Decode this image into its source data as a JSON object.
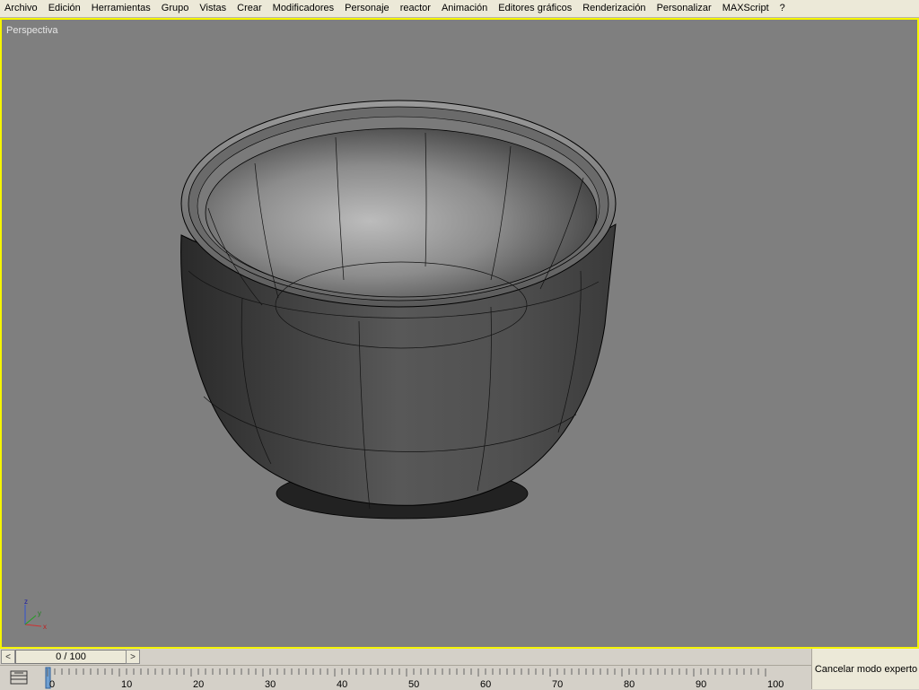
{
  "menu": {
    "items": [
      "Archivo",
      "Edición",
      "Herramientas",
      "Grupo",
      "Vistas",
      "Crear",
      "Modificadores",
      "Personaje",
      "reactor",
      "Animación",
      "Editores gráficos",
      "Renderización",
      "Personalizar",
      "MAXScript",
      "?"
    ]
  },
  "viewport": {
    "label": "Perspectiva",
    "border_color": "#f5f500",
    "background": "#7f7f7f",
    "object": "bowl"
  },
  "axis": {
    "x": "x",
    "y": "y",
    "z": "z"
  },
  "timeline": {
    "frame_display": "0 / 100",
    "prev_icon": "chevron-left-icon",
    "next_icon": "chevron-right-icon",
    "current_frame": 0,
    "total_frames": 100,
    "ticks": [
      "0",
      "10",
      "20",
      "30",
      "40",
      "50",
      "60",
      "70",
      "80",
      "90",
      "100"
    ]
  },
  "expert_button": {
    "label": "Cancelar modo experto"
  }
}
